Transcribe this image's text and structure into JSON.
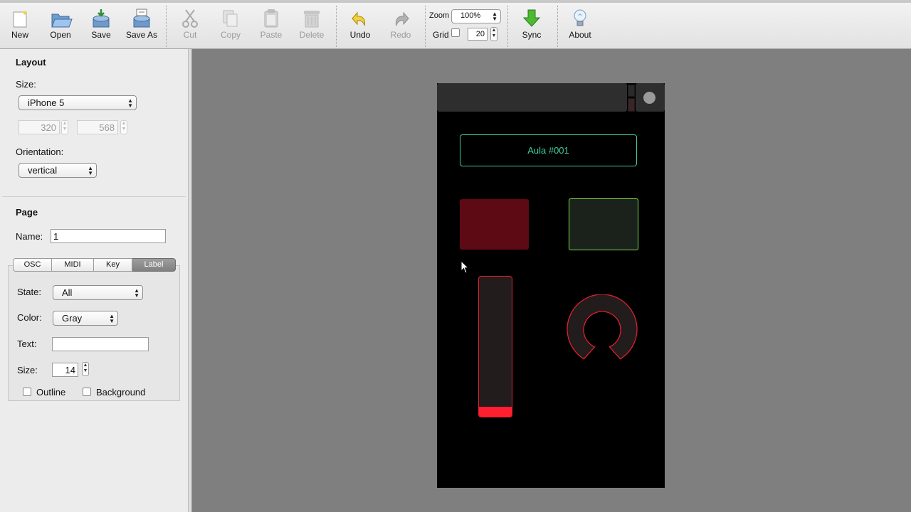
{
  "toolbar": {
    "new": "New",
    "open": "Open",
    "save": "Save",
    "save_as": "Save As",
    "cut": "Cut",
    "copy": "Copy",
    "paste": "Paste",
    "delete": "Delete",
    "undo": "Undo",
    "redo": "Redo",
    "zoom_label": "Zoom",
    "zoom_value": "100%",
    "grid_label": "Grid",
    "grid_checked": false,
    "grid_value": "20",
    "sync": "Sync",
    "about": "About"
  },
  "layout": {
    "title": "Layout",
    "size_label": "Size:",
    "size_value": "iPhone 5",
    "width": "320",
    "height": "568",
    "orientation_label": "Orientation:",
    "orientation_value": "vertical"
  },
  "page": {
    "title": "Page",
    "name_label": "Name:",
    "name_value": "1",
    "tabs": [
      "OSC",
      "MIDI",
      "Key",
      "Label"
    ],
    "active_tab": "Label"
  },
  "label_props": {
    "state_label": "State:",
    "state_value": "All",
    "color_label": "Color:",
    "color_value": "Gray",
    "text_label": "Text:",
    "text_value": "",
    "size_label": "Size:",
    "size_value": "14",
    "outline_label": "Outline",
    "outline_checked": false,
    "background_label": "Background",
    "background_checked": false
  },
  "canvas": {
    "label_text": "Aula #001",
    "label_color": "#3fcea0",
    "push_color": "#5e0a14",
    "toggle_color": "#7fe04a",
    "fader_color": "#ff1f2f",
    "fader_level": 0.07,
    "rotary_color": "#e0202c"
  }
}
